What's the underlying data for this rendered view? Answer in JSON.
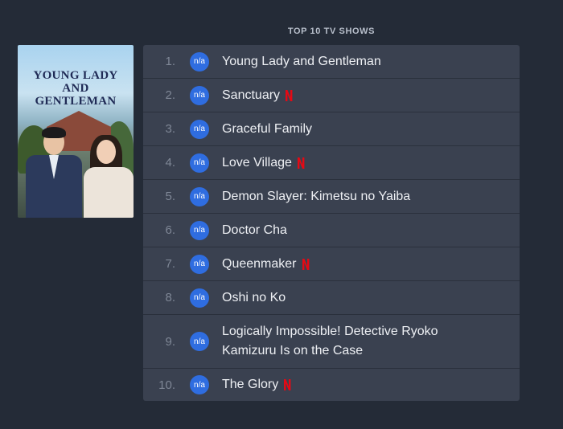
{
  "section": {
    "title": "TOP 10 TV SHOWS"
  },
  "poster": {
    "title_lines": "YOUNG LADY\nAND\nGENTLEMAN"
  },
  "accent": {
    "badge_color": "#2f6de0",
    "netflix_color": "#e50914"
  },
  "shows": [
    {
      "rank": "1.",
      "badge": "n/a",
      "title": "Young Lady and Gentleman",
      "netflix": false
    },
    {
      "rank": "2.",
      "badge": "n/a",
      "title": "Sanctuary",
      "netflix": true
    },
    {
      "rank": "3.",
      "badge": "n/a",
      "title": "Graceful Family",
      "netflix": false
    },
    {
      "rank": "4.",
      "badge": "n/a",
      "title": "Love Village",
      "netflix": true
    },
    {
      "rank": "5.",
      "badge": "n/a",
      "title": "Demon Slayer: Kimetsu no Yaiba",
      "netflix": false
    },
    {
      "rank": "6.",
      "badge": "n/a",
      "title": "Doctor Cha",
      "netflix": false
    },
    {
      "rank": "7.",
      "badge": "n/a",
      "title": "Queenmaker",
      "netflix": true
    },
    {
      "rank": "8.",
      "badge": "n/a",
      "title": "Oshi no Ko",
      "netflix": false
    },
    {
      "rank": "9.",
      "badge": "n/a",
      "title": "Logically Impossible! Detective Ryoko Kamizuru Is on the Case",
      "netflix": false
    },
    {
      "rank": "10.",
      "badge": "n/a",
      "title": "The Glory",
      "netflix": true
    }
  ]
}
